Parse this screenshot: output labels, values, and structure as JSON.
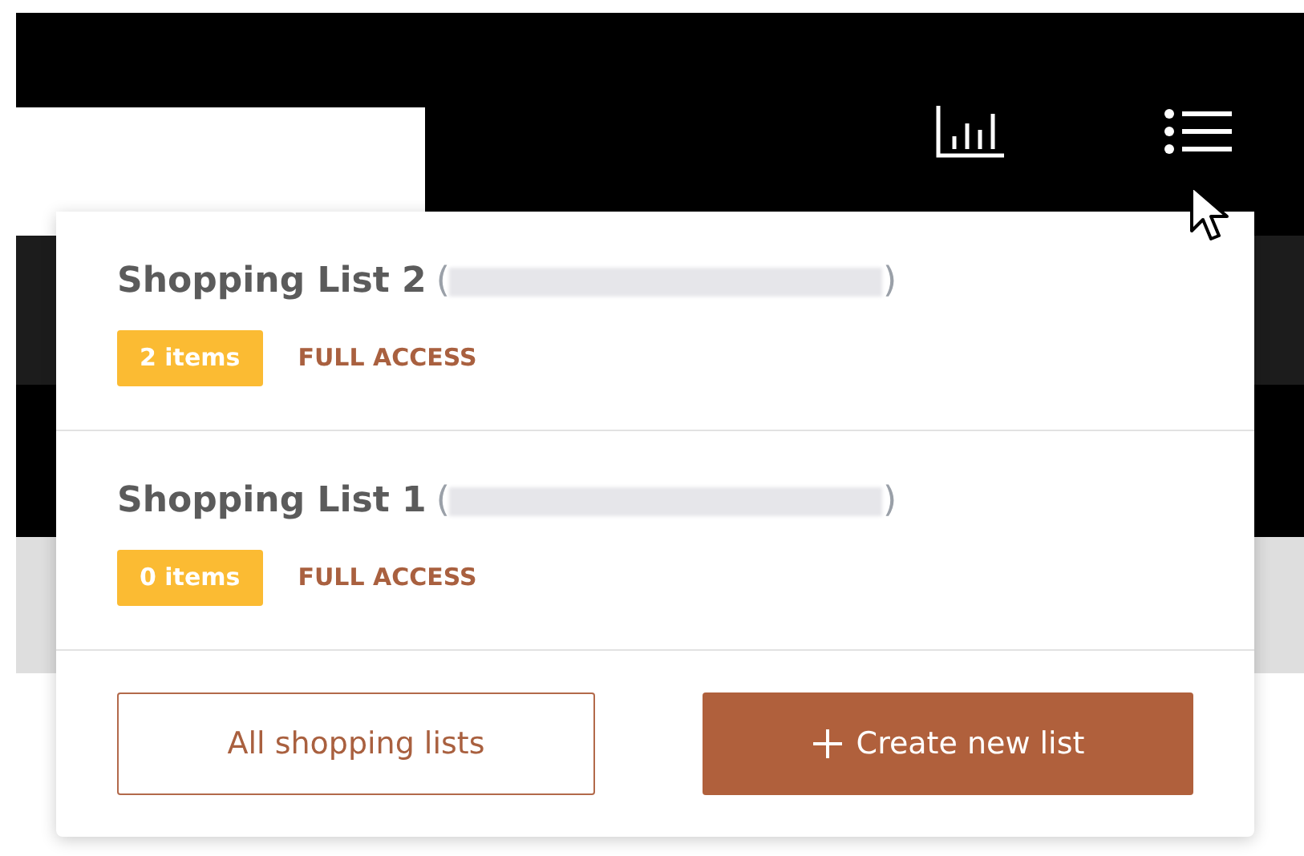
{
  "lists": [
    {
      "title": "Shopping List 2",
      "owner_open": "(",
      "owner_close": ")",
      "count": "2 items",
      "access": "FULL ACCESS"
    },
    {
      "title": "Shopping List 1",
      "owner_open": "(",
      "owner_close": ")",
      "count": "0 items",
      "access": "FULL ACCESS"
    }
  ],
  "buttons": [
    {
      "label": "All shopping lists",
      "kind": "outline"
    },
    {
      "label": "Create new list",
      "kind": "primary"
    }
  ]
}
